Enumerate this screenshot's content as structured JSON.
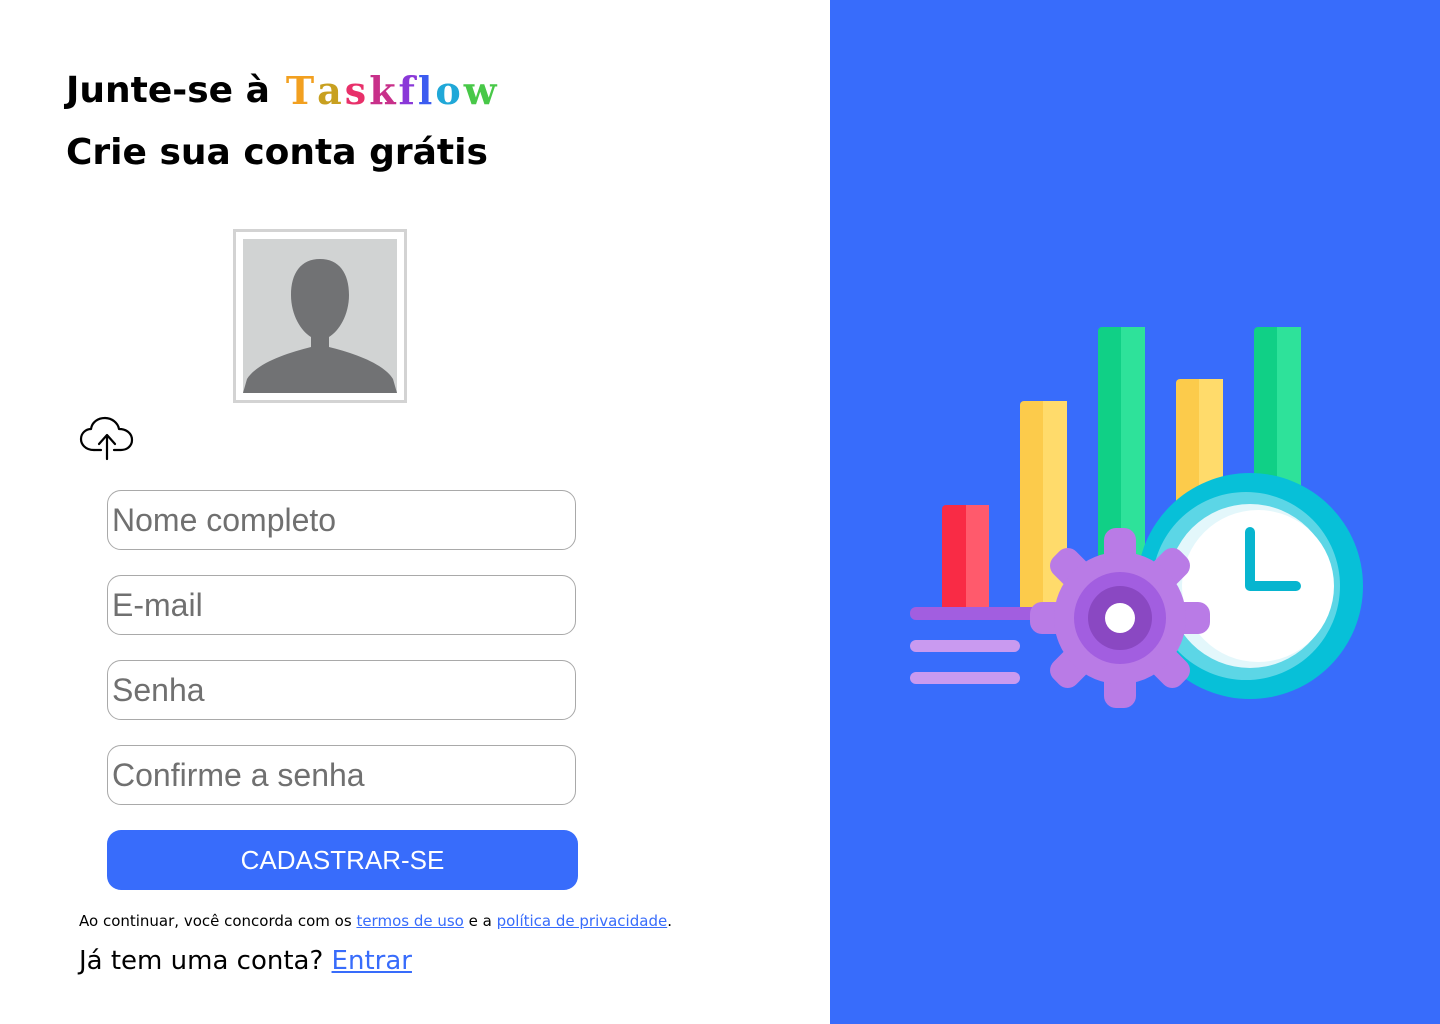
{
  "header": {
    "title_prefix": "Junte-se à",
    "brand": {
      "letters": [
        "T",
        "a",
        "s",
        "k",
        "f",
        "l",
        "o",
        "w"
      ],
      "colors": [
        "#f2a020",
        "#c8a020",
        "#e8306a",
        "#c8308a",
        "#8a38d8",
        "#3c5cf0",
        "#20a8d8",
        "#48c848"
      ]
    },
    "subtitle": "Crie sua conta grátis"
  },
  "avatar": {
    "icon": "user-silhouette-icon"
  },
  "upload": {
    "icon": "cloud-upload-icon"
  },
  "form": {
    "name_placeholder": "Nome completo",
    "email_placeholder": "E-mail",
    "password_placeholder": "Senha",
    "confirm_placeholder": "Confirme a senha",
    "submit_label": "CADASTRAR-SE"
  },
  "terms": {
    "prefix": "Ao continuar, você concorda com os ",
    "terms_link": "termos de uso",
    "middle": " e a ",
    "privacy_link": "política de privacidade",
    "suffix": "."
  },
  "login": {
    "prompt": "Já tem uma conta? ",
    "link": "Entrar"
  },
  "colors": {
    "accent": "#386cfb",
    "right_panel": "#386cfb"
  },
  "illustration": {
    "icon": "productivity-chart-gear-clock-icon"
  }
}
